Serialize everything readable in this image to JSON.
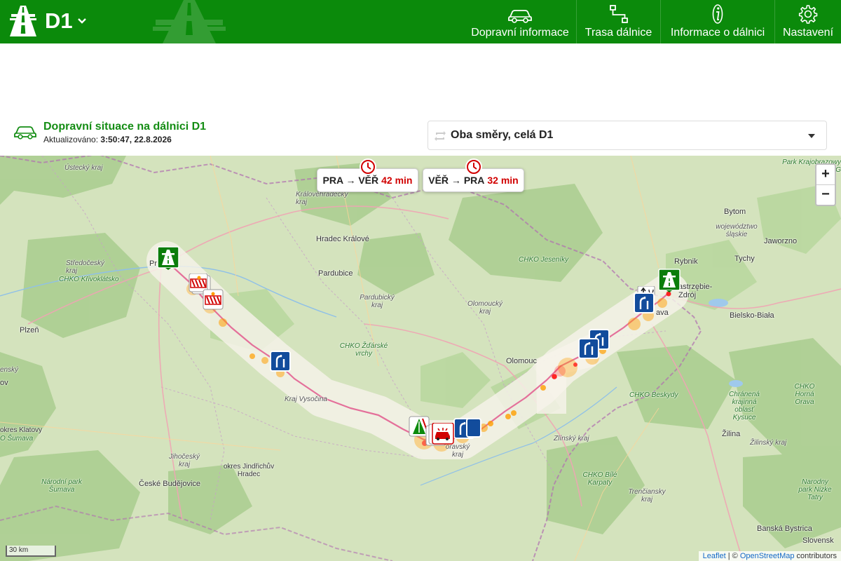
{
  "header": {
    "title": "D1",
    "nav": [
      {
        "label": "Dopravní informace",
        "icon": "car-icon"
      },
      {
        "label": "Trasa dálnice",
        "icon": "route-icon"
      },
      {
        "label": "Informace o dálnici",
        "icon": "info-icon"
      },
      {
        "label": "Nastavení",
        "icon": "gear-icon"
      }
    ]
  },
  "status": {
    "title": "Dopravní situace na dálnici D1",
    "updated_label": "Aktualizováno:",
    "updated_value": "3:50:47, 22.8.2026"
  },
  "direction": {
    "selected": "Oba směry, celá D1"
  },
  "travel_times": [
    {
      "route": "PRA → VĚŘ",
      "time": "42 min"
    },
    {
      "route": "VĚŘ → PRA",
      "time": "32 min"
    }
  ],
  "map": {
    "places": {
      "ustecky": "Ústecký kraj",
      "kralovehradecky": "Královéhradecký kraj",
      "hradec": "Hradec Králové",
      "praha": "Pr",
      "stredocesky": "Středočeský kraj",
      "krivoklatsko": "CHKO Křivoklátsko",
      "pardubice": "Pardubice",
      "pardubicky": "Pardubický kraj",
      "jeseniky": "CHKO Jeseníky",
      "olomoucky": "Olomoucký kraj",
      "zdarske": "CHKO Žďárské vrchy",
      "olomouc": "Olomouc",
      "vysocina": "Kraj Vysočina",
      "plzen": "Plzeň",
      "plzensky": "enský",
      "klatovy": "okres Klatovy",
      "sumava_chko": "O Šumava",
      "jihocesky": "Jihočeský kraj",
      "jindrichuv": "okres Jindřichův Hradec",
      "budejovice": "České Budějovice",
      "np_sumava": "Národní park Šumava",
      "moravsky": "oravský kraj",
      "zlinsky": "Zlínský kraj",
      "bile_karpaty": "CHKO Bílé Karpaty",
      "beskydy": "CHKO Beskydy",
      "trencin": "Trenčiansky kraj",
      "zilina": "Žilina",
      "zilinsky": "Žilinský kraj",
      "kysuce": "Chránená krajinná oblasť Kysuce",
      "horna_orava": "CHKO Horná Orava",
      "tatry": "Narodny park Nizke Tatry",
      "bystrica": "Banská Bystrica",
      "slovensko": "Slovensk",
      "bytom": "Bytom",
      "slaskie": "województwo śląskie",
      "jaworzno": "Jaworzno",
      "tychy": "Tychy",
      "rybnik": "Rybnik",
      "jastrzebie": "astrzębie-Zdrój",
      "bielsko": "Bielsko-Biała",
      "krajobrazowy": "Park Krajobrazowy Orlich G",
      "ava": "ava",
      "ov": "ov"
    },
    "scale": "30 km",
    "attribution": {
      "leaflet": "Leaflet",
      "sep": " | © ",
      "osm": "OpenStreetMap",
      "contributors": " contributors"
    },
    "zoom_in": "+",
    "zoom_out": "−"
  },
  "colors": {
    "header_green": "#0b8a0b",
    "title_green": "#148d14",
    "travel_time_red": "#d10000",
    "sign_blue": "#124c9c",
    "incident_orange": "#ff9e00",
    "incident_red": "#ff1a1a"
  }
}
